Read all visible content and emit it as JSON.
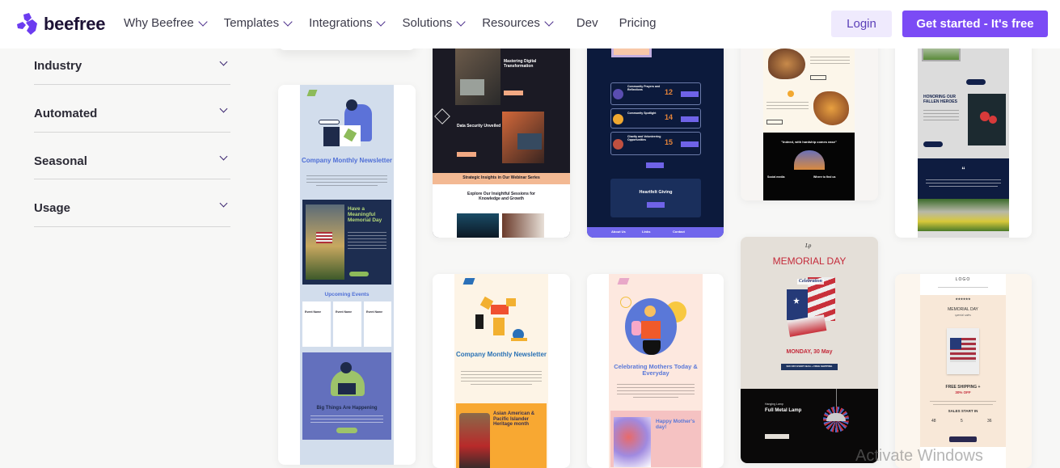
{
  "brand": {
    "name": "beefree",
    "accent": "#7b4bf5",
    "logo_color": "#6c3cf0"
  },
  "nav": {
    "items": [
      {
        "label": "Why Beefree",
        "has_dropdown": true
      },
      {
        "label": "Templates",
        "has_dropdown": true
      },
      {
        "label": "Integrations",
        "has_dropdown": true
      },
      {
        "label": "Solutions",
        "has_dropdown": true
      },
      {
        "label": "Resources",
        "has_dropdown": true
      },
      {
        "label": "Dev",
        "has_dropdown": false
      },
      {
        "label": "Pricing",
        "has_dropdown": false
      }
    ],
    "login_label": "Login",
    "cta_label": "Get started - It's free"
  },
  "sidebar": {
    "filters": [
      {
        "label": "Industry",
        "icon": "chevron-down-icon"
      },
      {
        "label": "Automated",
        "icon": "chevron-down-icon"
      },
      {
        "label": "Seasonal",
        "icon": "chevron-down-icon"
      },
      {
        "label": "Usage",
        "icon": "chevron-down-icon"
      }
    ]
  },
  "templates": [
    {
      "id": "company-newsletter-blue",
      "title": "Company Monthly Newsletter",
      "section2": "Have a Meaningful Memorial Day",
      "section3": "Upcoming Events",
      "section4": "Big Things Are Happening",
      "events": [
        "Event Name",
        "Event Name",
        "Event Name"
      ]
    },
    {
      "id": "webinar-series",
      "headline1": "Mastering Digital Transformation",
      "headline2": "Data Security Unveiled",
      "banner": "Strategic Insights in Our Webinar Series",
      "section": "Explore Our Insightful Sessions for Knowledge and Growth"
    },
    {
      "id": "community-events",
      "items": [
        {
          "title": "Community Prayers and Reflections",
          "day": "12"
        },
        {
          "title": "Community Spotlight",
          "day": "14"
        },
        {
          "title": "Charity and Volunteering Opportunities",
          "day": "15"
        }
      ],
      "section": "Heartfelt Giving",
      "footer": [
        "About Us",
        "Links",
        "Contact"
      ]
    },
    {
      "id": "ramadan",
      "quote": "\"Indeed, with hardship comes ease\"",
      "footer_left": "Social media",
      "footer_right": "Where to find us"
    },
    {
      "id": "memorial-honor",
      "headline": "HONORING OUR FALLEN HEROES",
      "quote_mark": "“"
    },
    {
      "id": "company-newsletter-orange",
      "title": "Company Monthly Newsletter",
      "section": "Asian American & Pacific Islander Heritage month"
    },
    {
      "id": "mothers-day",
      "title": "Celebrating Mothers Today & Everyday",
      "section": "Happy Mother's day!"
    },
    {
      "id": "memorial-day-sale",
      "title": "MEMORIAL DAY",
      "script": "Celebration",
      "date": "MONDAY, 30 May",
      "offer": "$40 OFF EVERY BAG + FREE SHIPPING",
      "product_tag": "Hanging Lamp",
      "product": "Full Metal Lamp"
    },
    {
      "id": "memorial-day-shop",
      "logo": "LOGO",
      "stars": "★★★★★★",
      "title": "MEMORIAL DAY",
      "subtitle": "special sales",
      "offer1": "FREE SHIPPING +",
      "offer2": "30% OFF",
      "countdown_label": "SALES START IN",
      "countdown": [
        {
          "value": "48"
        },
        {
          "value": "5"
        },
        {
          "value": "36"
        }
      ]
    }
  ],
  "watermark": "Activate Windows"
}
